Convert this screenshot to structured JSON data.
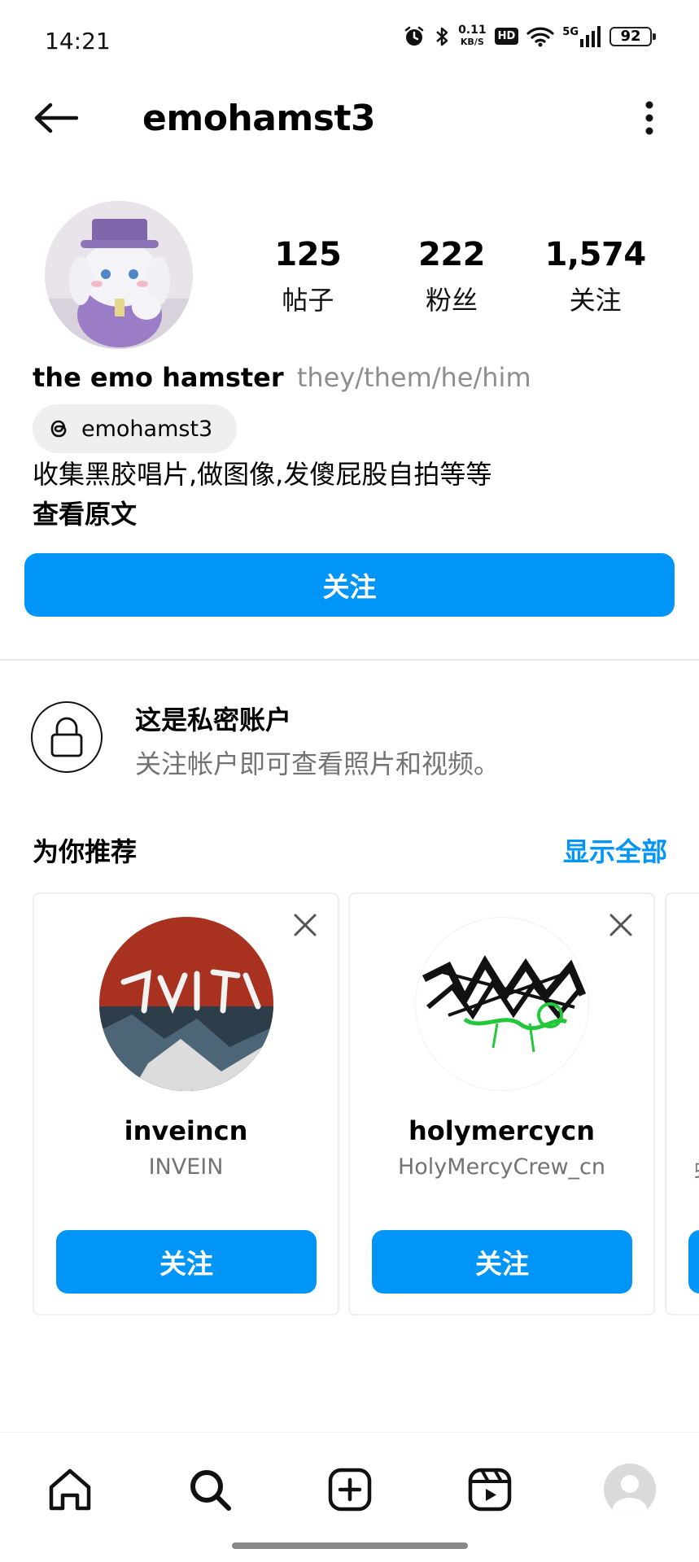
{
  "status_bar": {
    "time": "14:21",
    "speed_value": "0.11",
    "speed_unit": "KB/S",
    "hd_badge": "HD",
    "network": "5G",
    "battery": "92",
    "icons": [
      "alarm-icon",
      "bluetooth-icon",
      "wifi-icon",
      "signal-icon"
    ]
  },
  "header": {
    "title": "emohamst3",
    "back_icon": "arrow-left-icon",
    "more_icon": "more-vertical-icon"
  },
  "profile": {
    "stats": [
      {
        "value": "125",
        "label": "帖子"
      },
      {
        "value": "222",
        "label": "粉丝"
      },
      {
        "value": "1,574",
        "label": "关注"
      }
    ],
    "display_name": "the emo hamster",
    "pronouns": "they/them/he/him",
    "threads_handle": "emohamst3",
    "bio": "收集黑胶唱片,做图像,发傻屁股自拍等等",
    "see_original": "查看原文",
    "follow_label": "关注"
  },
  "private": {
    "title": "这是私密账户",
    "subtitle": "关注帐户即可查看照片和视频。"
  },
  "suggestions": {
    "title": "为你推荐",
    "see_all": "显示全部",
    "cards": [
      {
        "username": "inveincn",
        "name": "INVEIN",
        "button": "关注"
      },
      {
        "username": "holymercycn",
        "name": "HolyMercyCrew_cn",
        "button": "关注"
      }
    ],
    "peek_char": "蚌"
  },
  "bottom_nav": {
    "items": [
      "home-icon",
      "search-icon",
      "create-icon",
      "reels-icon",
      "profile-avatar"
    ]
  },
  "colors": {
    "accent": "#0095f6",
    "muted_text": "#737373",
    "pronoun_text": "#8e8e8e"
  }
}
